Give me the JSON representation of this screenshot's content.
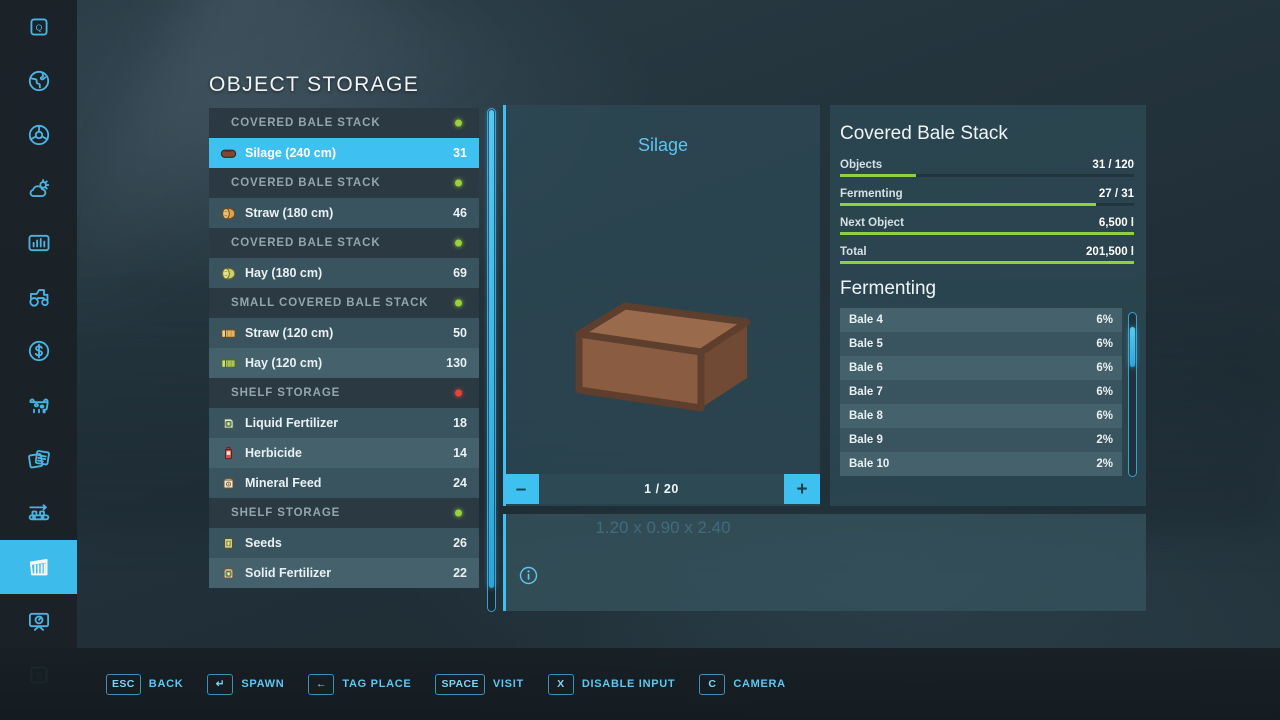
{
  "page": {
    "title": "OBJECT STORAGE"
  },
  "sidebar": {
    "items": [
      {
        "icon": "quickmenu-key-icon",
        "name": "quick-menu",
        "active": false
      },
      {
        "icon": "globe-icon",
        "name": "map",
        "active": false
      },
      {
        "icon": "steering-wheel-icon",
        "name": "vehicle-control",
        "active": false
      },
      {
        "icon": "weather-icon",
        "name": "weather",
        "active": false
      },
      {
        "icon": "statistics-icon",
        "name": "statistics",
        "active": false
      },
      {
        "icon": "tractor-icon",
        "name": "vehicles",
        "active": false
      },
      {
        "icon": "dollar-icon",
        "name": "finances",
        "active": false
      },
      {
        "icon": "cow-icon",
        "name": "animals",
        "active": false
      },
      {
        "icon": "contracts-icon",
        "name": "contracts",
        "active": false
      },
      {
        "icon": "production-icon",
        "name": "production",
        "active": false
      },
      {
        "icon": "object-storage-icon",
        "name": "object-storage",
        "active": true
      },
      {
        "icon": "construction-icon",
        "name": "construction",
        "active": false
      },
      {
        "icon": "exit-key-icon",
        "name": "exit",
        "active": false
      }
    ]
  },
  "storage_list": {
    "rows": [
      {
        "type": "group",
        "label": "COVERED BALE STACK",
        "status_color": "#9ad13c"
      },
      {
        "type": "item",
        "icon": "silage-bale-icon",
        "label": "Silage (240 cm)",
        "count": "31",
        "selected": true
      },
      {
        "type": "group",
        "label": "COVERED BALE STACK",
        "status_color": "#9ad13c"
      },
      {
        "type": "item",
        "icon": "straw-round-bale-icon",
        "label": "Straw (180 cm)",
        "count": "46",
        "selected": false
      },
      {
        "type": "group",
        "label": "COVERED BALE STACK",
        "status_color": "#9ad13c"
      },
      {
        "type": "item",
        "icon": "hay-round-bale-icon",
        "label": "Hay (180 cm)",
        "count": "69",
        "selected": false
      },
      {
        "type": "group",
        "label": "SMALL COVERED BALE STACK",
        "status_color": "#9ad13c"
      },
      {
        "type": "item",
        "icon": "straw-square-bale-icon",
        "label": "Straw (120 cm)",
        "count": "50",
        "selected": false
      },
      {
        "type": "item",
        "icon": "hay-square-bale-icon",
        "label": "Hay (120 cm)",
        "count": "130",
        "selected": false
      },
      {
        "type": "group",
        "label": "SHELF STORAGE",
        "status_color": "#e5443a"
      },
      {
        "type": "item",
        "icon": "liquid-fertilizer-icon",
        "label": "Liquid Fertilizer",
        "count": "18",
        "selected": false
      },
      {
        "type": "item",
        "icon": "herbicide-icon",
        "label": "Herbicide",
        "count": "14",
        "selected": false
      },
      {
        "type": "item",
        "icon": "mineral-feed-icon",
        "label": "Mineral Feed",
        "count": "24",
        "selected": false
      },
      {
        "type": "group",
        "label": "SHELF STORAGE",
        "status_color": "#9ad13c"
      },
      {
        "type": "item",
        "icon": "seeds-icon",
        "label": "Seeds",
        "count": "26",
        "selected": false
      },
      {
        "type": "item",
        "icon": "solid-fertilizer-icon",
        "label": "Solid Fertilizer",
        "count": "22",
        "selected": false
      }
    ]
  },
  "preview": {
    "name": "Silage",
    "dimensions": "1.20 x 0.90 x 2.40",
    "pager": {
      "minus": "–",
      "plus": "+",
      "value": "1 / 20"
    }
  },
  "detail": {
    "title": "Covered Bale Stack",
    "stats": [
      {
        "label": "Objects",
        "value": "31 / 120",
        "fill": 26
      },
      {
        "label": "Fermenting",
        "value": "27 / 31",
        "fill": 87
      },
      {
        "label": "Next Object",
        "value": "6,500 l",
        "fill": 100
      },
      {
        "label": "Total",
        "value": "201,500 l",
        "fill": 100
      }
    ],
    "fermenting_title": "Fermenting",
    "fermenting": [
      {
        "label": "Bale 4",
        "value": "6%"
      },
      {
        "label": "Bale 5",
        "value": "6%"
      },
      {
        "label": "Bale 6",
        "value": "6%"
      },
      {
        "label": "Bale 7",
        "value": "6%"
      },
      {
        "label": "Bale 8",
        "value": "6%"
      },
      {
        "label": "Bale 9",
        "value": "2%"
      },
      {
        "label": "Bale 10",
        "value": "2%"
      }
    ]
  },
  "help_bar": {
    "items": [
      {
        "key": "ESC",
        "label": "BACK"
      },
      {
        "key": "↵",
        "label": "SPAWN"
      },
      {
        "key": "←",
        "label": "TAG PLACE"
      },
      {
        "key": "SPACE",
        "label": "VISIT"
      },
      {
        "key": "X",
        "label": "DISABLE INPUT"
      },
      {
        "key": "C",
        "label": "CAMERA"
      }
    ]
  },
  "colors": {
    "accent": "#3ec0f0",
    "progress": "#8fd13f",
    "status_ok": "#9ad13c",
    "status_alert": "#e5443a",
    "panel": "#2d4954"
  }
}
